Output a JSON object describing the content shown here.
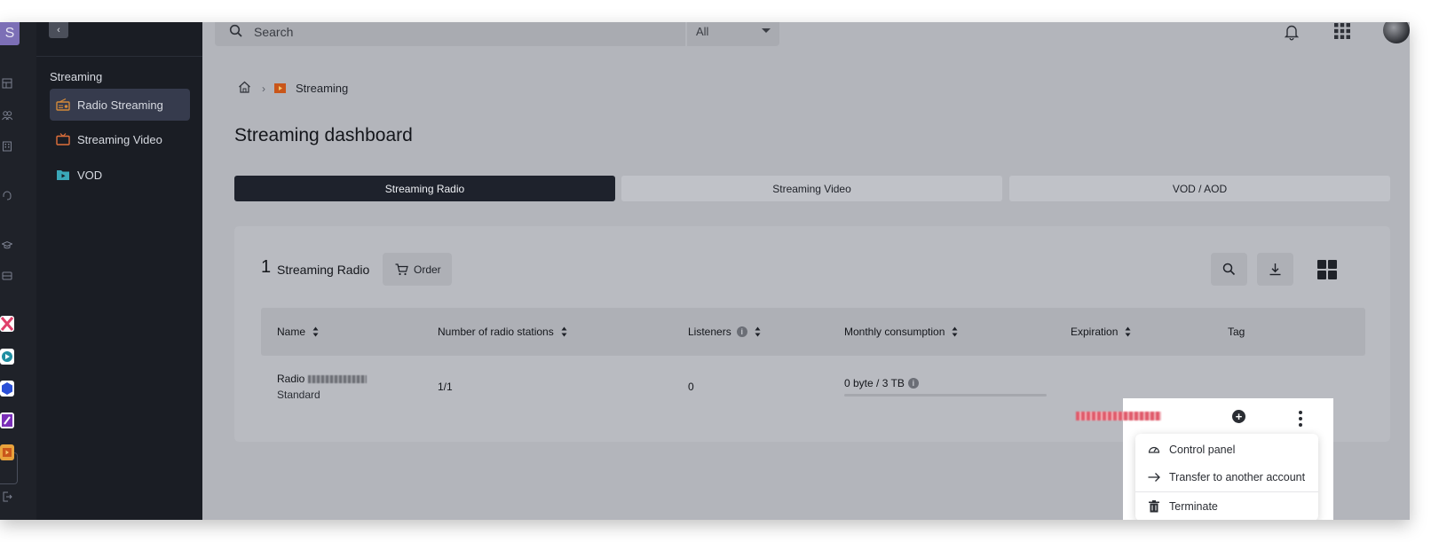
{
  "rail": {
    "logo_letter": "S"
  },
  "sidebar": {
    "section_title": "Streaming",
    "items": [
      {
        "label": "Radio Streaming",
        "icon": "radio-icon",
        "active": true,
        "icon_color": "#d48a3a"
      },
      {
        "label": "Streaming Video",
        "icon": "tv-icon",
        "active": false,
        "icon_color": "#e0703b"
      },
      {
        "label": "VOD",
        "icon": "vod-icon",
        "active": false,
        "icon_color": "#3aa7b8"
      }
    ]
  },
  "topbar": {
    "search_placeholder": "Search",
    "scope_value": "All"
  },
  "breadcrumb": {
    "current": "Streaming"
  },
  "page": {
    "title": "Streaming dashboard"
  },
  "tabs": [
    {
      "label": "Streaming Radio",
      "active": true
    },
    {
      "label": "Streaming Video",
      "active": false
    },
    {
      "label": "VOD / AOD",
      "active": false
    }
  ],
  "card": {
    "count": "1",
    "title": "Streaming Radio",
    "order_label": "Order"
  },
  "table": {
    "headers": {
      "name": "Name",
      "stations": "Number of radio stations",
      "listeners": "Listeners",
      "consumption": "Monthly consumption",
      "expiration": "Expiration",
      "tag": "Tag"
    },
    "rows": [
      {
        "name": "Radio",
        "plan": "Standard",
        "stations": "1/1",
        "listeners": "0",
        "consumption": "0 byte / 3 TB"
      }
    ]
  },
  "context_menu": {
    "items": [
      {
        "label": "Control panel",
        "icon": "gauge-icon"
      },
      {
        "label": "Transfer to another account",
        "icon": "arrow-right-icon"
      },
      {
        "label": "Terminate",
        "icon": "trash-icon"
      }
    ]
  },
  "colors": {
    "sidebar_bg": "#1a1d24",
    "overlay_bg": "#b3b5bb",
    "active_tab": "#1e222c",
    "expiration_text": "#e05a6a"
  }
}
